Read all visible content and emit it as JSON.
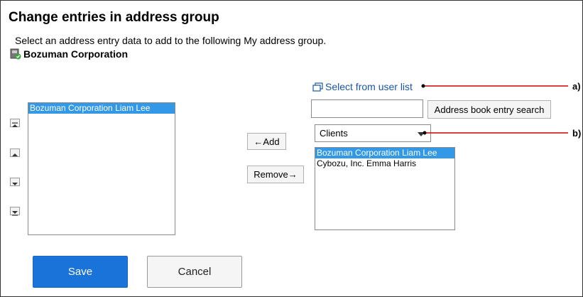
{
  "page": {
    "title": "Change entries in address group",
    "description": "Select an address entry data to add to the following My address group.",
    "group_name": "Bozuman Corporation"
  },
  "members_list": {
    "items": [
      {
        "label": "Bozuman Corporation Liam Lee",
        "selected": true
      }
    ]
  },
  "transfer": {
    "add_label": "←Add",
    "remove_label": "Remove→"
  },
  "source": {
    "user_list_link": "Select from user list",
    "search_value": "",
    "search_button": "Address book entry search",
    "category_selected": "Clients",
    "items": [
      {
        "label": "Bozuman Corporation Liam Lee",
        "selected": true
      },
      {
        "label": "Cybozu, Inc. Emma Harris",
        "selected": false
      }
    ]
  },
  "actions": {
    "save_label": "Save",
    "cancel_label": "Cancel"
  },
  "callouts": {
    "a": "a)",
    "b": "b)"
  },
  "colors": {
    "accent": "#1a73d9",
    "selection": "#3399e6",
    "link": "#1a56a3",
    "callout_line": "#cc0000"
  },
  "icons": {
    "group": "address-group-icon",
    "move_top": "move-top-icon",
    "move_up": "move-up-icon",
    "move_down": "move-down-icon",
    "move_bottom": "move-bottom-icon",
    "popup": "popup-window-icon",
    "dropdown": "chevron-down-icon"
  }
}
